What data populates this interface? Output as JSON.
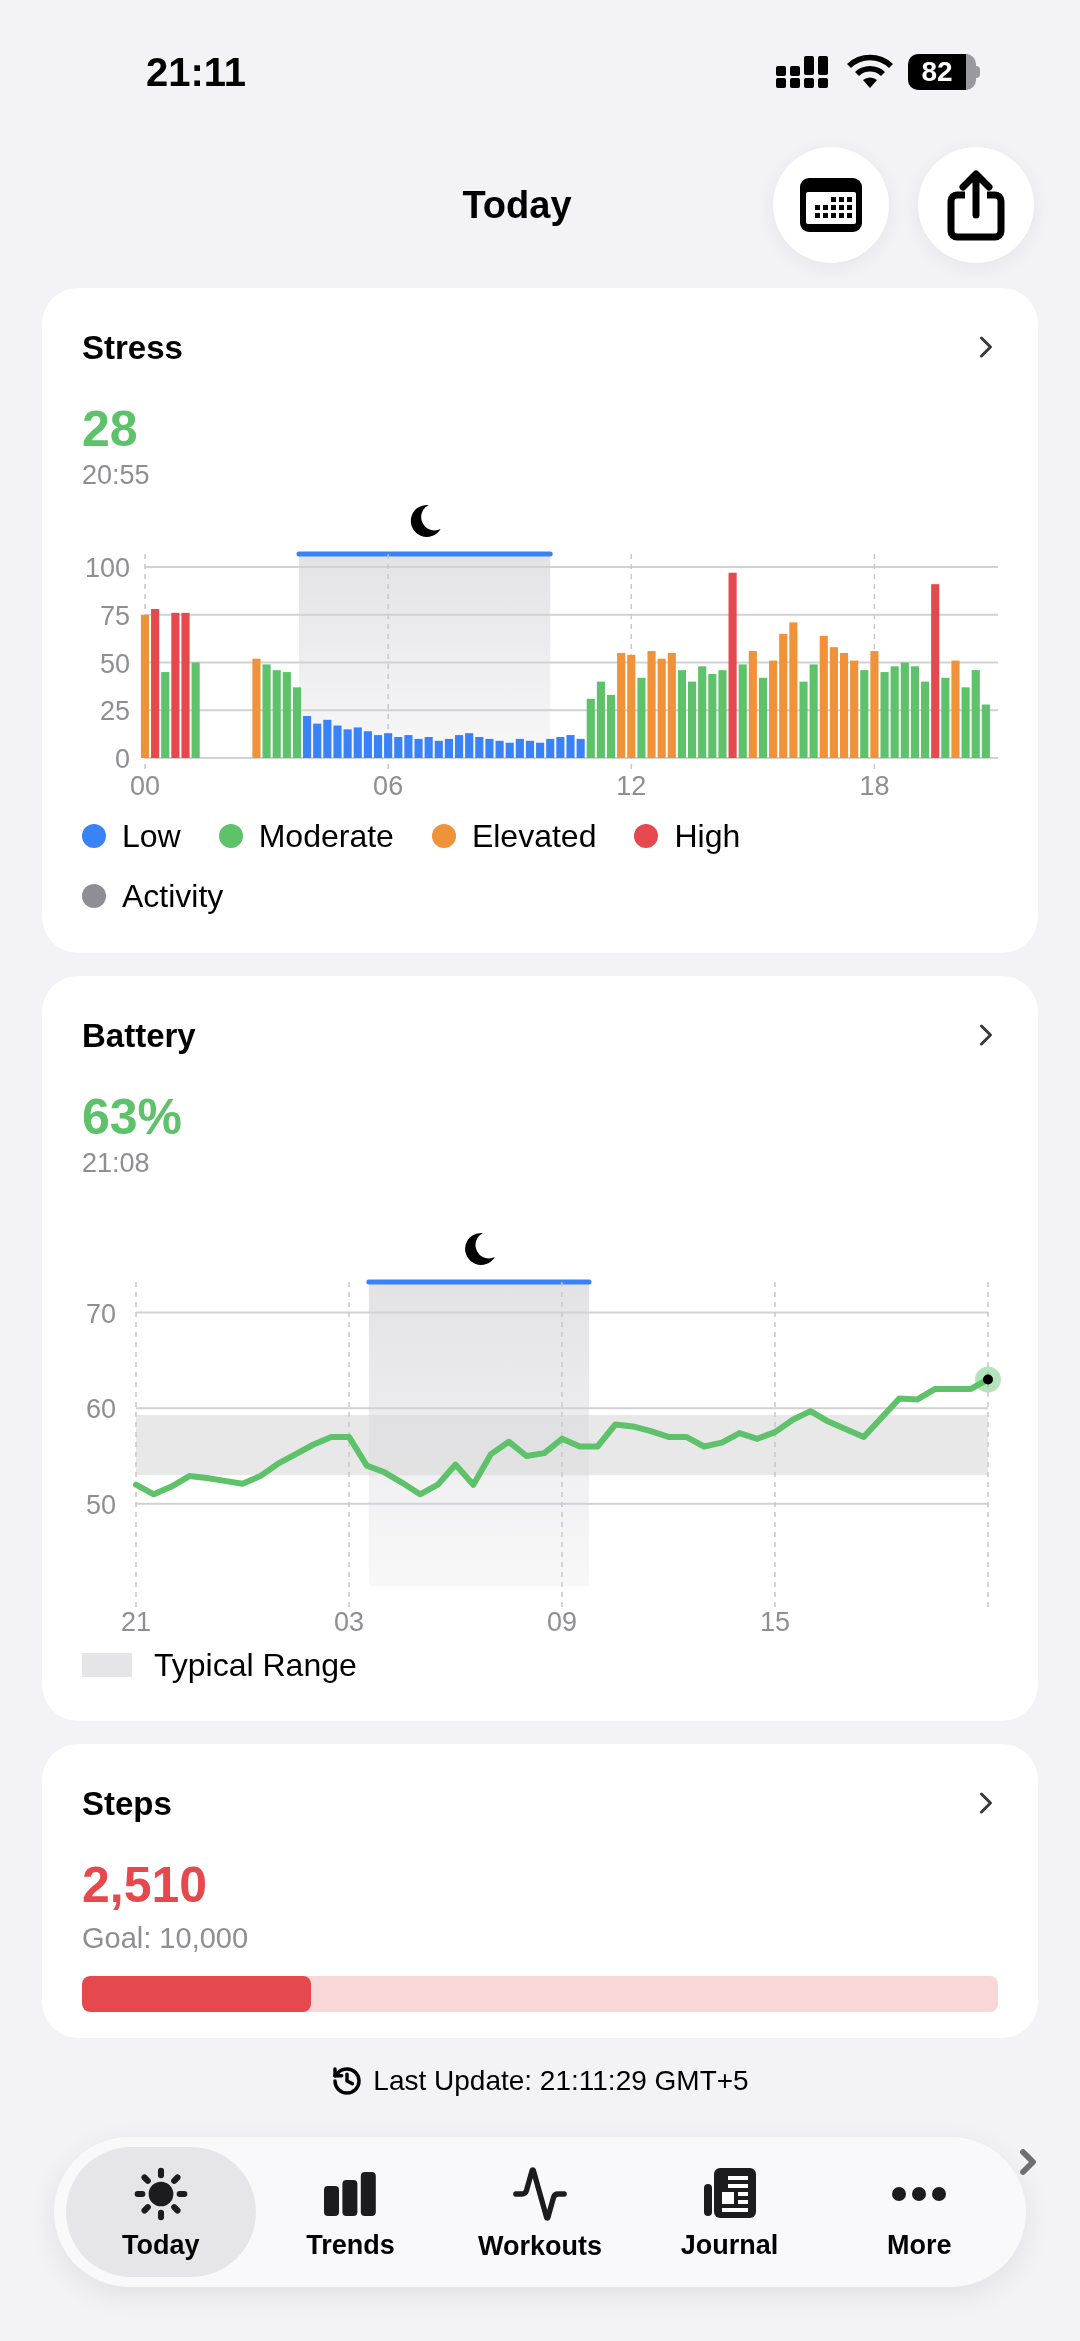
{
  "status_bar": {
    "time": "21:11",
    "battery": "82"
  },
  "header": {
    "title": "Today"
  },
  "stress": {
    "title": "Stress",
    "value": "28",
    "time": "20:55",
    "chart_data": {
      "type": "bar",
      "x": [
        0,
        0.25,
        0.5,
        0.75,
        1,
        1.25,
        2.75,
        3,
        3.25,
        3.5,
        3.75,
        4,
        4.25,
        4.5,
        4.75,
        5,
        5.25,
        5.5,
        5.75,
        6,
        6.25,
        6.5,
        6.75,
        7,
        7.25,
        7.5,
        7.75,
        8,
        8.25,
        8.5,
        8.75,
        9,
        9.25,
        9.5,
        9.75,
        10,
        10.25,
        10.5,
        10.75,
        11,
        11.25,
        11.5,
        11.75,
        12,
        12.25,
        12.5,
        12.75,
        13,
        13.25,
        13.5,
        13.75,
        14,
        14.25,
        14.5,
        14.75,
        15,
        15.25,
        15.5,
        15.75,
        16,
        16.25,
        16.5,
        16.75,
        17,
        17.25,
        17.5,
        17.75,
        18,
        18.25,
        18.5,
        18.75,
        19,
        19.25,
        19.5,
        19.75,
        20,
        20.25,
        20.5,
        20.75
      ],
      "series": [
        {
          "values": [
            75,
            78,
            45,
            76,
            76,
            50,
            52,
            49,
            46,
            45,
            37,
            22,
            18,
            20,
            17,
            15,
            16,
            14,
            12,
            13,
            11,
            12,
            10,
            11,
            9,
            10,
            12,
            13,
            11,
            10,
            9,
            8,
            10,
            9,
            8,
            10,
            11,
            12,
            10,
            31,
            40,
            33,
            55,
            54,
            42,
            56,
            52,
            55,
            46,
            40,
            48,
            44,
            46,
            97,
            49,
            56,
            42,
            51,
            65,
            71,
            40,
            49,
            64,
            58,
            55,
            51,
            46,
            56,
            45,
            48,
            50,
            48,
            40,
            91,
            42,
            51,
            37,
            46,
            28
          ]
        }
      ],
      "xlim": [
        0,
        21
      ],
      "ylim": [
        0,
        100
      ],
      "grid": true,
      "xticks": [
        {
          "value": 0,
          "label": "00"
        },
        {
          "value": 6,
          "label": "06"
        },
        {
          "value": 12,
          "label": "12"
        },
        {
          "value": 18,
          "label": "18"
        }
      ],
      "yticks": [
        0,
        25,
        50,
        75,
        100
      ]
    },
    "legend": [
      {
        "label": "Low",
        "color": "#3a82f7"
      },
      {
        "label": "Moderate",
        "color": "#5ec26a"
      },
      {
        "label": "Elevated",
        "color": "#f0923a"
      },
      {
        "label": "High",
        "color": "#e5484d"
      },
      {
        "label": "Activity",
        "color": "#8e8e93"
      }
    ]
  },
  "battery": {
    "title": "Battery",
    "value": "63%",
    "time": "21:08",
    "chart_data": {
      "type": "line",
      "categories": [
        "21",
        null,
        null,
        null,
        null,
        null,
        null,
        null,
        null,
        null,
        null,
        null,
        "03",
        null,
        null,
        null,
        null,
        null,
        null,
        null,
        null,
        null,
        null,
        null,
        "09",
        null,
        null,
        null,
        null,
        null,
        null,
        null,
        null,
        null,
        null,
        null,
        "15",
        null,
        null,
        null,
        null,
        null,
        null,
        null,
        null,
        null,
        null,
        null,
        null
      ],
      "series": [
        {
          "color": "#5ec26a",
          "values": [
            52,
            51,
            51.8,
            52.9,
            52.7,
            52.4,
            52.1,
            52.9,
            54.2,
            55.2,
            56.2,
            57,
            57,
            54,
            53.3,
            52.2,
            51,
            52,
            54.1,
            52,
            55.2,
            56.5,
            55,
            55.3,
            56.8,
            56,
            56,
            58.3,
            58.1,
            57.6,
            57,
            57,
            56,
            56.4,
            57.4,
            56.8,
            57.5,
            58.8,
            59.7,
            58.6,
            57.8,
            57,
            59,
            61,
            60.9,
            62,
            62,
            62,
            63
          ]
        }
      ],
      "ylim": [
        39,
        73.2
      ],
      "grid": true,
      "bands": [
        {
          "axis": "y",
          "from": 53,
          "to": 59.3
        }
      ],
      "yticks": [
        50,
        60,
        70
      ]
    },
    "legend": [
      {
        "label": "Typical Range"
      }
    ]
  },
  "steps": {
    "title": "Steps",
    "value": "2,510",
    "goal": "Goal: 10,000",
    "level": 0.25
  },
  "last_update": "Last Update: 21:11:29 GMT+5",
  "tab_bar": {
    "tabs": [
      {
        "label": "Today",
        "kind": "sun",
        "selected": true
      },
      {
        "label": "Trends",
        "kind": "bars",
        "selected": false
      },
      {
        "label": "Workouts",
        "kind": "pulse",
        "selected": false
      },
      {
        "label": "Journal",
        "kind": "news",
        "selected": false
      },
      {
        "label": "More",
        "kind": "more",
        "selected": false
      }
    ]
  }
}
